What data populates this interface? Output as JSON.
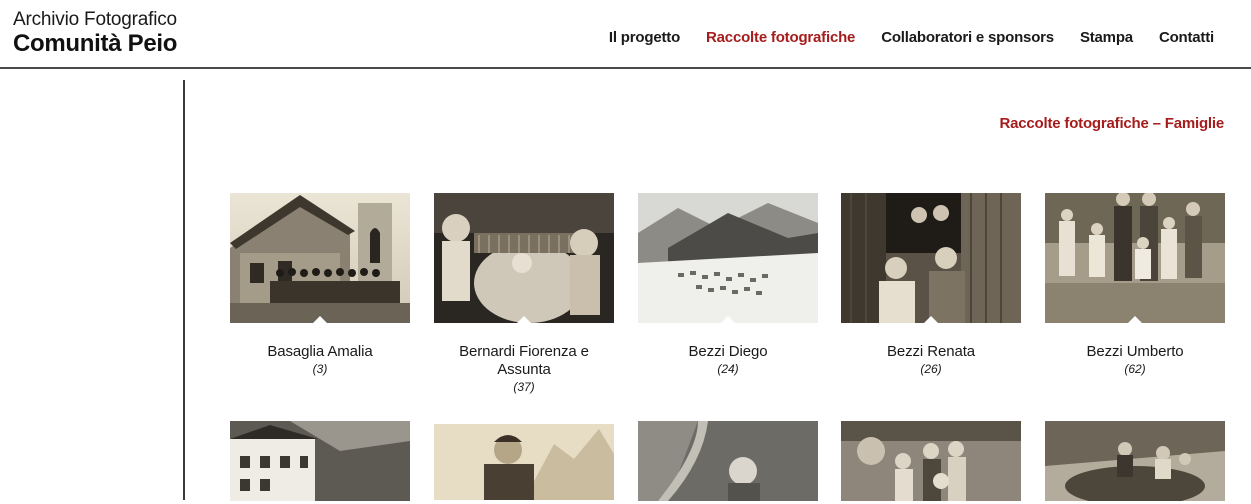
{
  "header": {
    "logo_line1": "Archivio Fotografico",
    "logo_line2": "Comunità Peio"
  },
  "nav": [
    {
      "label": "Il progetto",
      "active": false
    },
    {
      "label": "Raccolte fotografiche",
      "active": true
    },
    {
      "label": "Collaboratori e sponsors",
      "active": false
    },
    {
      "label": "Stampa",
      "active": false
    },
    {
      "label": "Contatti",
      "active": false
    }
  ],
  "page_title": "Raccolte fotografiche – Famiglie",
  "collections": [
    {
      "name": "Basaglia Amalia",
      "count": "(3)"
    },
    {
      "name": "Bernardi Fiorenza e Assunta",
      "count": "(37)"
    },
    {
      "name": "Bezzi Diego",
      "count": "(24)"
    },
    {
      "name": "Bezzi Renata",
      "count": "(26)"
    },
    {
      "name": "Bezzi Umberto",
      "count": "(62)"
    }
  ],
  "colors": {
    "accent": "#a61c1c",
    "text": "#1a1a1a",
    "divider": "#3a3a3a"
  }
}
